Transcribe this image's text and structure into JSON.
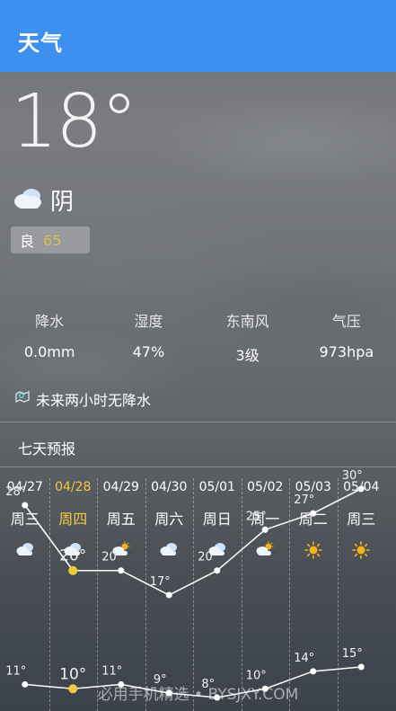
{
  "app": {
    "title": "天气"
  },
  "current": {
    "temperature": "18°",
    "condition": "阴",
    "condition_icon": "cloud-icon",
    "aqi_label": "良",
    "aqi_value": "65"
  },
  "stats": [
    {
      "label": "降水",
      "value": "0.0mm"
    },
    {
      "label": "湿度",
      "value": "47%"
    },
    {
      "label": "东南风",
      "value": "3级"
    },
    {
      "label": "气压",
      "value": "973hpa"
    }
  ],
  "rain_notice": "未来两小时无降水",
  "forecast_title": "七天预报",
  "colors": {
    "accent": "#3d8ff0",
    "today": "#f5c93d",
    "sun": "#f5b316"
  },
  "days": [
    {
      "date": "04/27",
      "weekday": "周三",
      "icon": "sun-cloud-icon",
      "high": 28,
      "low": 11,
      "today": false
    },
    {
      "date": "04/28",
      "weekday": "周四",
      "icon": "sun-cloud-icon",
      "high": 20,
      "low": 10,
      "today": true
    },
    {
      "date": "04/29",
      "weekday": "周五",
      "icon": "cloud-sun-icon",
      "high": 20,
      "low": 11,
      "today": false
    },
    {
      "date": "04/30",
      "weekday": "周六",
      "icon": "sun-cloud-icon",
      "high": 17,
      "low": 9,
      "today": false
    },
    {
      "date": "05/01",
      "weekday": "周日",
      "icon": "sun-cloud-icon",
      "high": 20,
      "low": 8,
      "today": false
    },
    {
      "date": "05/02",
      "weekday": "周一",
      "icon": "cloud-sun-icon",
      "high": 25,
      "low": 10,
      "today": false
    },
    {
      "date": "05/03",
      "weekday": "周二",
      "icon": "sun-icon",
      "high": 27,
      "low": 14,
      "today": false
    },
    {
      "date": "05/04",
      "weekday": "周三",
      "icon": "sun-icon",
      "high": 30,
      "low": 15,
      "today": false
    }
  ],
  "chart_data": {
    "type": "line",
    "categories": [
      "04/27",
      "04/28",
      "04/29",
      "04/30",
      "05/01",
      "05/02",
      "05/03",
      "05/04"
    ],
    "series": [
      {
        "values": [
          28,
          20,
          20,
          17,
          20,
          25,
          27,
          30
        ]
      },
      {
        "values": [
          11,
          10,
          11,
          9,
          8,
          10,
          14,
          15
        ]
      }
    ],
    "highlight_index": 1,
    "ylim": [
      8,
      30
    ]
  },
  "watermark": "必用手机精选 • BYSJXY.COM"
}
